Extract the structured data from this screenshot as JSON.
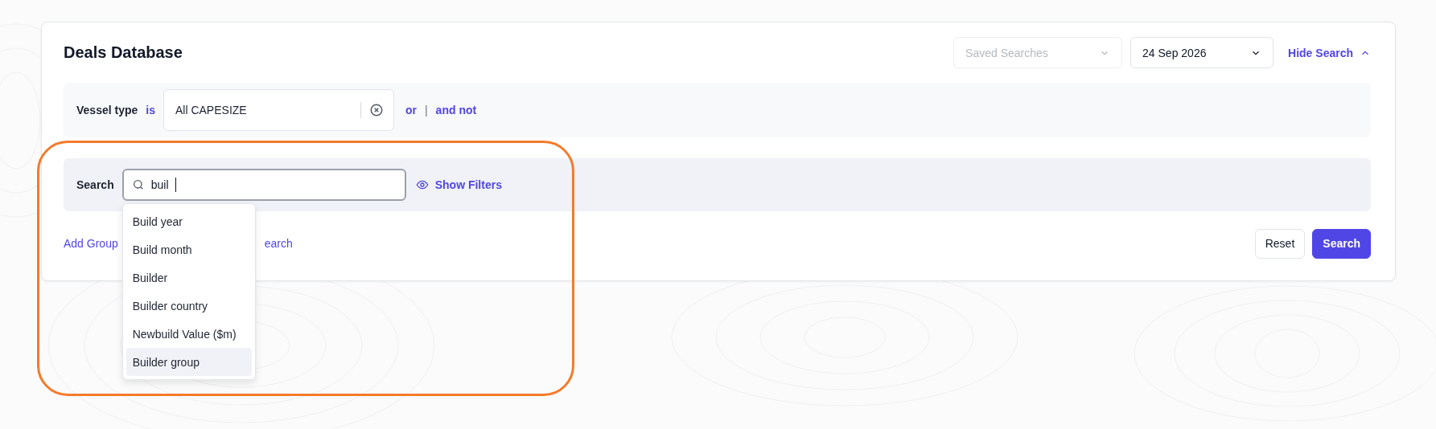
{
  "header": {
    "title": "Deals Database",
    "saved_searches": {
      "placeholder": "Saved Searches"
    },
    "date": {
      "value": "24 Sep 2026"
    },
    "toggle": {
      "label": "Hide Search",
      "expanded": true
    }
  },
  "vessel_filter": {
    "label": "Vessel type",
    "operator": "is",
    "value": "All CAPESIZE",
    "or_label": "or",
    "separator": "|",
    "and_not_label": "and not"
  },
  "search": {
    "label": "Search",
    "value": "buil",
    "show_filters": "Show Filters"
  },
  "suggestions": [
    {
      "label": "Build year",
      "selected": false
    },
    {
      "label": "Build month",
      "selected": false
    },
    {
      "label": "Builder",
      "selected": false
    },
    {
      "label": "Builder country",
      "selected": false
    },
    {
      "label": "Newbuild Value ($m)",
      "selected": false
    },
    {
      "label": "Builder group",
      "selected": true
    }
  ],
  "footer": {
    "add_group": "Add Group",
    "hidden_link": "earch",
    "reset": "Reset",
    "search": "Search"
  },
  "annotation": {
    "kind": "highlight"
  }
}
